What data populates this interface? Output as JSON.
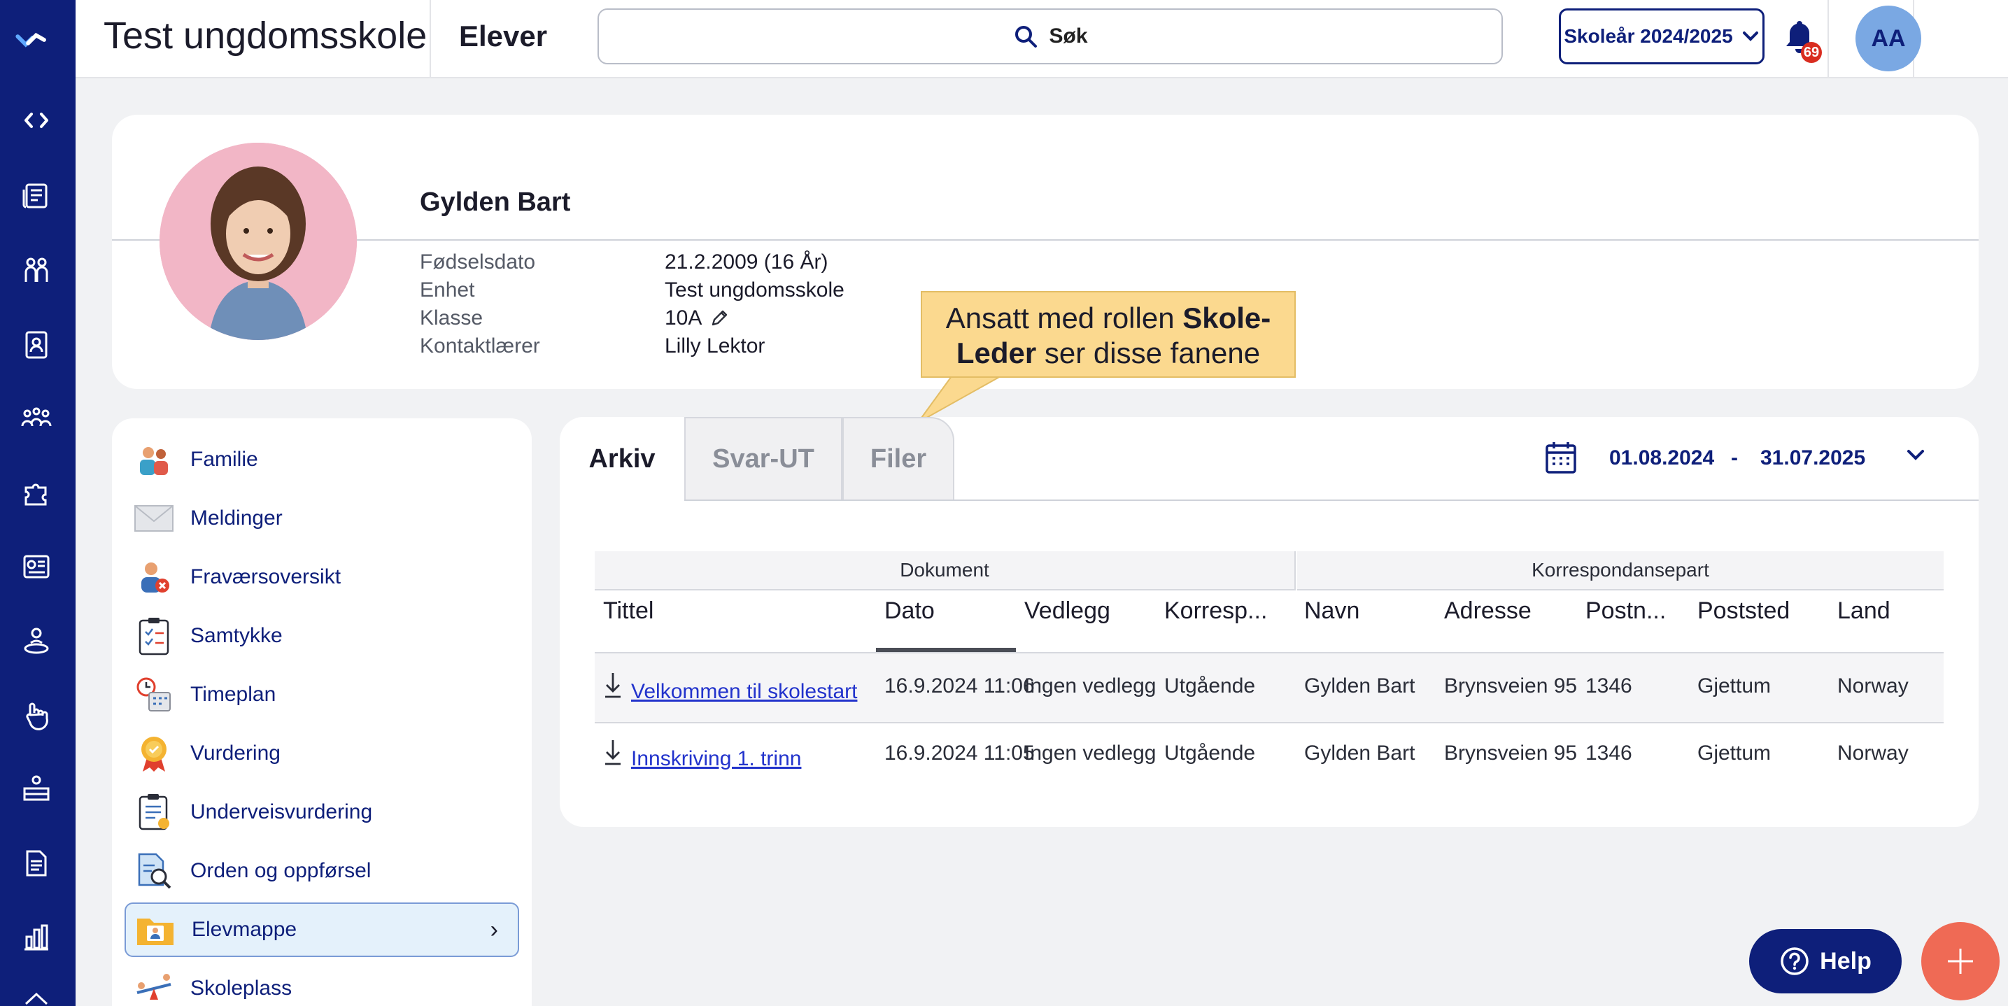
{
  "topbar": {
    "school_name": "Test ungdomsskole",
    "module_title": "Elever",
    "search_placeholder": "Søk",
    "school_year": "Skoleår 2024/2025",
    "notification_count": "69",
    "user_initials": "AA"
  },
  "student": {
    "name": "Gylden Bart",
    "fields": [
      {
        "label": "Fødselsdato",
        "value": "21.2.2009 (16 År)"
      },
      {
        "label": "Enhet",
        "value": "Test ungdomsskole"
      },
      {
        "label": "Klasse",
        "value": "10A"
      },
      {
        "label": "Kontaktlærer",
        "value": "Lilly Lektor"
      }
    ]
  },
  "callout": {
    "line1_prefix": "Ansatt med rollen ",
    "line1_bold": "Skole-",
    "line2_bold": "Leder",
    "line2_suffix": " ser disse fanene"
  },
  "menu": {
    "items": [
      {
        "label": "Familie",
        "icon": "family-icon"
      },
      {
        "label": "Meldinger",
        "icon": "envelope-icon"
      },
      {
        "label": "Fraværsoversikt",
        "icon": "absence-icon"
      },
      {
        "label": "Samtykke",
        "icon": "consent-clipboard-icon"
      },
      {
        "label": "Timeplan",
        "icon": "timetable-icon"
      },
      {
        "label": "Vurdering",
        "icon": "medal-icon"
      },
      {
        "label": "Underveisvurdering",
        "icon": "assessment-clipboard-icon"
      },
      {
        "label": "Orden og oppførsel",
        "icon": "document-search-icon"
      },
      {
        "label": "Elevmappe",
        "icon": "student-folder-icon",
        "active": true
      },
      {
        "label": "Skoleplass",
        "icon": "seesaw-icon"
      }
    ]
  },
  "tabs": [
    "Arkiv",
    "Svar-UT",
    "Filer"
  ],
  "date_range": {
    "from": "01.08.2024",
    "separator": "-",
    "to": "31.07.2025"
  },
  "table": {
    "groups": [
      "Dokument",
      "Korrespondansepart"
    ],
    "columns": [
      "Tittel",
      "Dato",
      "Vedlegg",
      "Korresp...",
      "Navn",
      "Adresse",
      "Postn...",
      "Poststed",
      "Land"
    ],
    "rows": [
      [
        "Velkommen til skolestart",
        "16.9.2024  11:06",
        "Ingen vedlegg",
        "Utgående",
        "Gylden Bart",
        "Brynsveien 95",
        "1346",
        "Gjettum",
        "Norway"
      ],
      [
        "Innskriving 1. trinn",
        "16.9.2024  11:05",
        "Ingen vedlegg",
        "Utgående",
        "Gylden Bart",
        "Brynsveien 95",
        "1346",
        "Gjettum",
        "Norway"
      ]
    ]
  },
  "help_label": "Help",
  "colors": {
    "brand_navy": "#0e1f7a",
    "accent_coral": "#ef6a55",
    "callout_yellow": "#fbd98f"
  }
}
